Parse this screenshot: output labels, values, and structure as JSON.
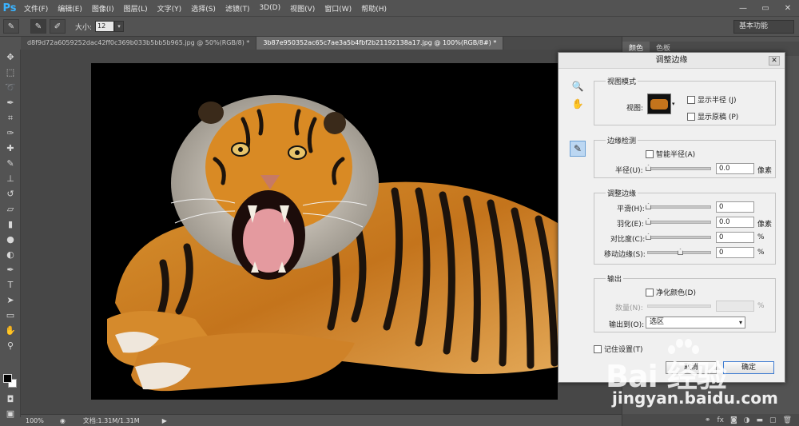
{
  "app": {
    "logo": "Ps",
    "accent": "#3ab3ff"
  },
  "menu": [
    "文件(F)",
    "编辑(E)",
    "图像(I)",
    "图层(L)",
    "文字(Y)",
    "选择(S)",
    "滤镜(T)",
    "3D(D)",
    "视图(V)",
    "窗口(W)",
    "帮助(H)"
  ],
  "window_controls": [
    "—",
    "▭",
    "✕"
  ],
  "options_bar": {
    "size_label": "大小:",
    "size_value": "12",
    "workspace": "基本功能"
  },
  "tabs": [
    {
      "label": "d8f9d72a6059252dac42ff0c369b033b5bb5b965.jpg @ 50%(RGB/8) *",
      "active": false
    },
    {
      "label": "3b87e950352ac65c7ae3a5b4fbf2b21192138a17.jpg @ 100%(RGB/8#) *",
      "active": true
    }
  ],
  "status": {
    "zoom": "100%",
    "doc": "文档:1.31M/1.31M"
  },
  "right_panel": {
    "tabs": [
      "颜色",
      "色板"
    ]
  },
  "dialog": {
    "title": "调整边缘",
    "view_mode": {
      "title": "视图模式",
      "view_label": "视图:",
      "show_radius": "显示半径 (J)",
      "show_original": "显示原稿 (P)"
    },
    "edge_detection": {
      "title": "边缘检测",
      "smart_radius": "智能半径(A)",
      "radius_label": "半径(U):",
      "radius_value": "0.0",
      "radius_unit": "像素"
    },
    "adjust_edge": {
      "title": "调整边缘",
      "smooth_label": "平滑(H):",
      "smooth_value": "0",
      "feather_label": "羽化(E):",
      "feather_value": "0.0",
      "feather_unit": "像素",
      "contrast_label": "对比度(C):",
      "contrast_value": "0",
      "contrast_unit": "%",
      "shift_label": "移动边缘(S):",
      "shift_value": "0",
      "shift_unit": "%"
    },
    "output": {
      "title": "输出",
      "decontaminate": "净化颜色(D)",
      "amount_label": "数量(N):",
      "amount_unit": "%",
      "output_to_label": "输出到(O):",
      "output_to_value": "选区"
    },
    "remember": "记住设置(T)",
    "cancel": "取消",
    "ok": "确定"
  },
  "watermark": {
    "logo": "Bai 经验",
    "url": "jingyan.baidu.com"
  }
}
